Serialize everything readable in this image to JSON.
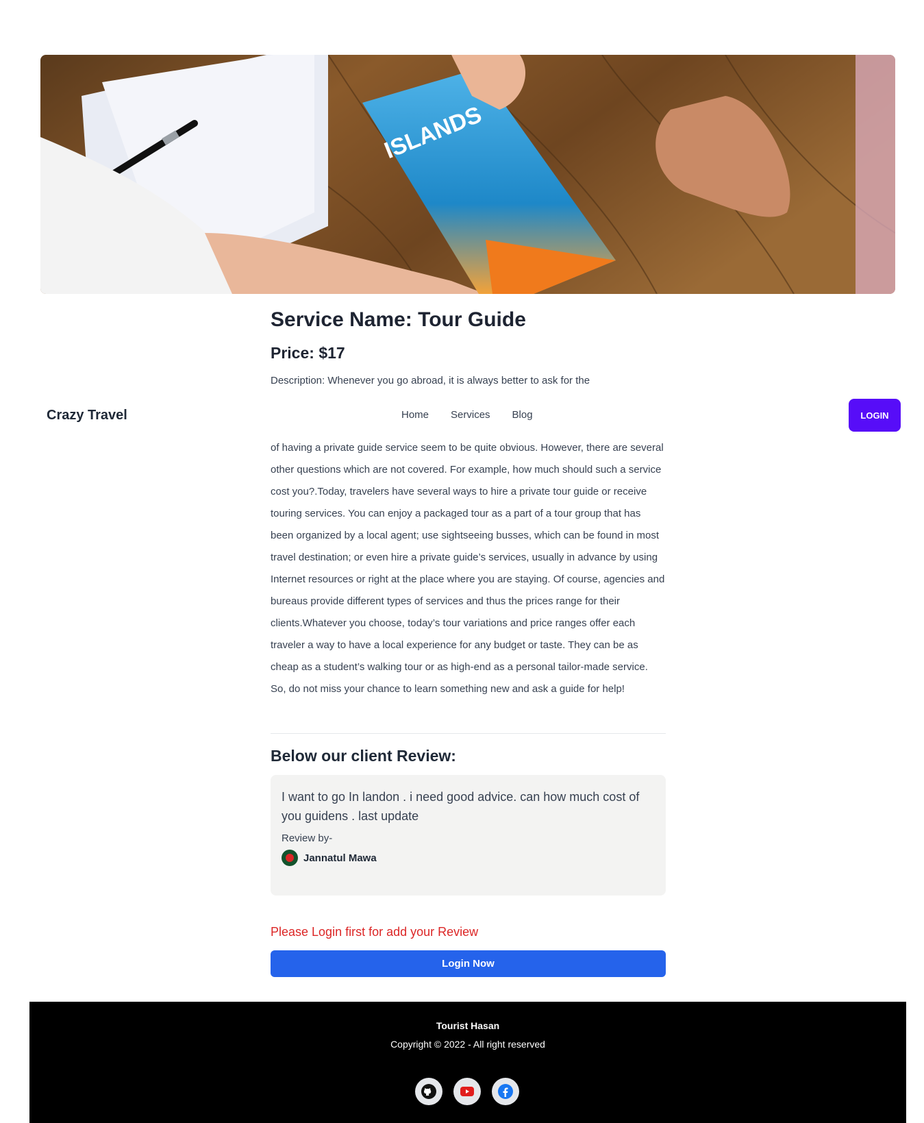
{
  "hero": {
    "image_alt": "Hands exchanging an ISLANDS travel brochure over a wooden desk",
    "brochure_text": "ISLANDS"
  },
  "service": {
    "title": "Service Name: Tour Guide",
    "price": "Price: $17",
    "description_first_line": "Description: Whenever you go abroad, it is always better to ask for the",
    "description_rest": "of having a private guide service seem to be quite obvious. However, there are several other questions which are not covered. For example, how much should such a service cost you?.Today, travelers have several ways to hire a private tour guide or receive touring services. You can enjoy a packaged tour as a part of a tour group that has been organized by a local agent; use sightseeing busses, which can be found in most travel destination; or even hire a private guide’s services, usually in advance by using Internet resources or right at the place where you are staying. Of course, agencies and bureaus provide different types of services and thus the prices range for their clients.Whatever you choose, today’s tour variations and price ranges offer each traveler a way to have a local experience for any budget or taste. They can be as cheap as a student’s walking tour or as high-end as a personal tailor-made service. So, do not miss your chance to learn something new and ask a guide for help!"
  },
  "navbar": {
    "brand": "Crazy Travel",
    "links": [
      "Home",
      "Services",
      "Blog"
    ],
    "login_label": "LOGIN",
    "login_color": "#570df8"
  },
  "reviews": {
    "heading": "Below our client Review:",
    "items": [
      {
        "text": "I want to go In landon . i need good advice. can how much cost of you guidens . last update",
        "by_label": "Review by-",
        "reviewer": "Jannatul Mawa"
      }
    ]
  },
  "login_prompt": {
    "warning": "Please Login first for add your Review",
    "warning_color": "#dc2626",
    "button_label": "Login Now",
    "button_color": "#2563eb"
  },
  "footer": {
    "name": "Tourist Hasan",
    "copyright": "Copyright © 2022 - All right reserved",
    "social_icons": [
      "github-icon",
      "youtube-icon",
      "facebook-icon"
    ]
  }
}
